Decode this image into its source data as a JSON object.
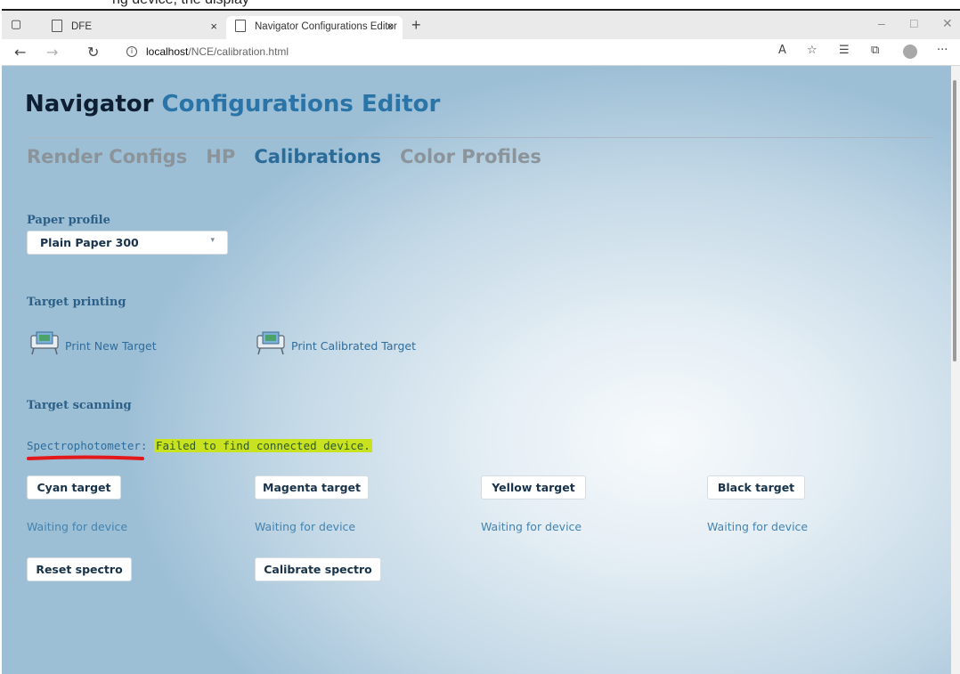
{
  "caption": {
    "text": "ng device, the display"
  },
  "browser": {
    "tabs": [
      {
        "title": "DFE",
        "active": false
      },
      {
        "title": "Navigator Configurations Editor",
        "active": true
      }
    ],
    "address": {
      "host": "localhost",
      "path": "/NCE/calibration.html"
    },
    "icons": {
      "tab_actions": "tab-actions-icon",
      "back": "back-arrow-icon",
      "forward": "forward-arrow-icon",
      "refresh": "refresh-icon",
      "info": "info-icon",
      "read_aloud": "read-aloud-icon",
      "favorite": "add-favorite-icon",
      "favorites": "favorites-icon",
      "collections": "collections-icon",
      "profile": "profile-icon",
      "more": "more-icon"
    },
    "glyphs": {
      "close": "×",
      "new_tab": "+",
      "minimize": "–",
      "maximize": "□",
      "window_close": "✕",
      "back": "←",
      "forward": "→",
      "refresh": "↻",
      "info": "i",
      "read_aloud": "A",
      "favorite": "☆",
      "favorites": "☰",
      "collections": "⧉",
      "more": "···"
    }
  },
  "page": {
    "title_part1": "Navigator",
    "title_part2": "Configurations Editor",
    "nav": [
      {
        "label": "Render Configs",
        "active": false
      },
      {
        "label": "HP",
        "active": false
      },
      {
        "label": "Calibrations",
        "active": true
      },
      {
        "label": "Color Profiles",
        "active": false
      }
    ],
    "paper_profile": {
      "label": "Paper profile",
      "selected": "Plain Paper 300",
      "chevron": "▾"
    },
    "target_printing": {
      "label": "Target printing",
      "print_new": "Print New Target",
      "print_calibrated": "Print Calibrated Target"
    },
    "target_scanning": {
      "label": "Target scanning",
      "spectro_label": "Spectrophotometer:",
      "spectro_status": "Failed to find connected device."
    },
    "targets": [
      {
        "button": "Cyan target",
        "status": "Waiting for device"
      },
      {
        "button": "Magenta target",
        "status": "Waiting for device"
      },
      {
        "button": "Yellow target",
        "status": "Waiting for device"
      },
      {
        "button": "Black target",
        "status": "Waiting for device"
      }
    ],
    "actions": {
      "reset": "Reset spectro",
      "calibrate": "Calibrate spectro"
    }
  },
  "colors": {
    "accent": "#2b74a8",
    "nav_inactive": "#8c949b",
    "highlight": "#c8e21f",
    "annotation": "#e3181b"
  }
}
